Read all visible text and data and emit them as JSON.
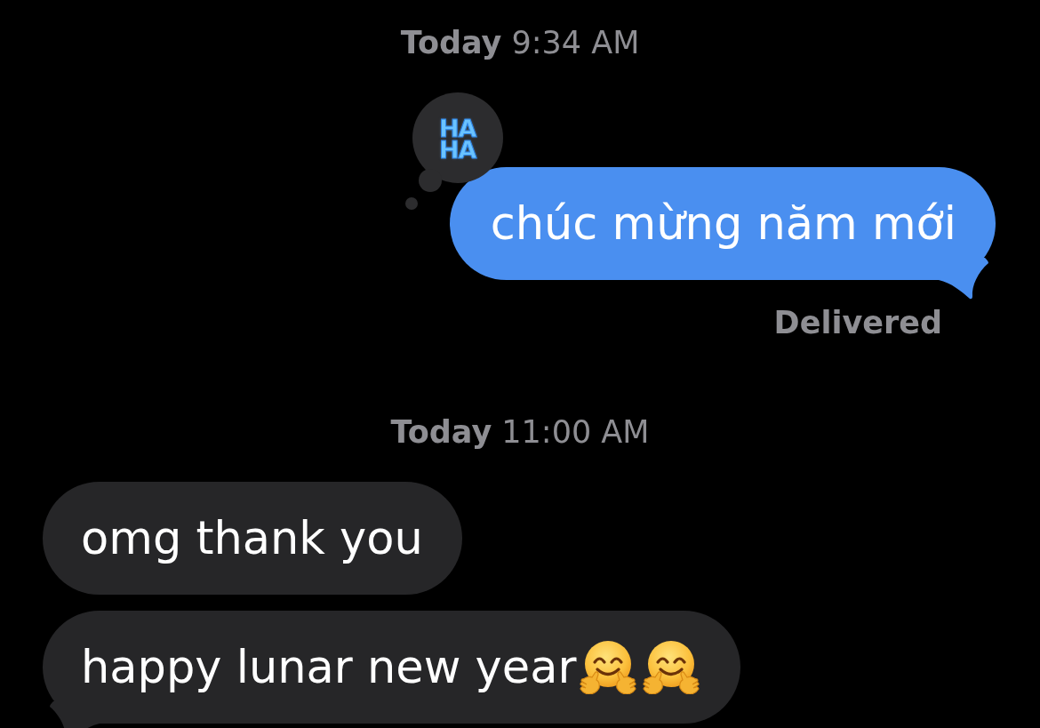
{
  "thread": [
    {
      "kind": "timestamp",
      "text": "**Today** 9:34 AM"
    },
    {
      "kind": "sent",
      "parts": [
        {
          "kind": "text",
          "text": "chúc mừng năm mới"
        }
      ],
      "tail": true,
      "reaction": {
        "lines": [
          "HA",
          "HA"
        ]
      },
      "status": "Delivered"
    },
    {
      "kind": "timestamp",
      "text": "**Today** 11:00 AM"
    },
    {
      "kind": "received",
      "parts": [
        {
          "kind": "text",
          "text": "omg thank you"
        }
      ],
      "tail": false
    },
    {
      "kind": "received",
      "parts": [
        {
          "kind": "text",
          "text": "happy lunar new year"
        },
        {
          "kind": "hug-emoji"
        },
        {
          "kind": "hug-emoji"
        }
      ],
      "tail": true
    }
  ]
}
